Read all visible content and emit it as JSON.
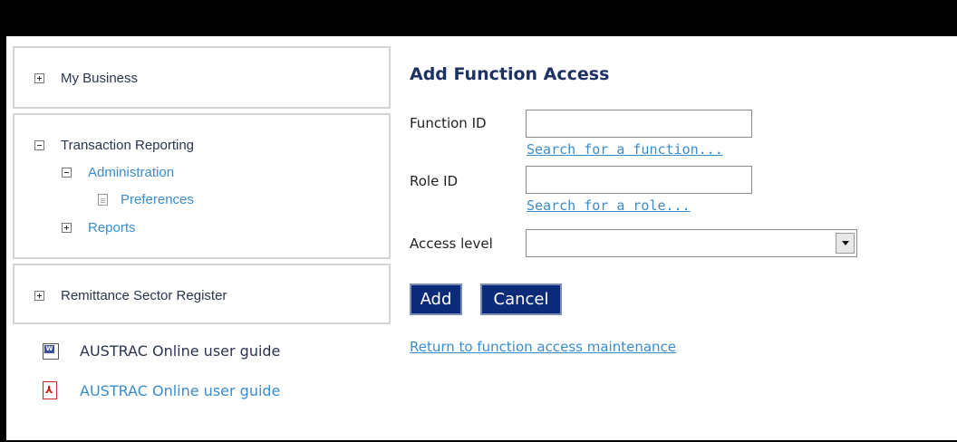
{
  "nav": {
    "my_business": "My Business",
    "transaction_reporting": "Transaction Reporting",
    "administration": "Administration",
    "preferences": "Preferences",
    "reports": "Reports",
    "remittance_sector_register": "Remittance Sector Register"
  },
  "guides": [
    {
      "label": "AUSTRAC Online user guide",
      "icon": "word-doc-icon"
    },
    {
      "label": "AUSTRAC Online user guide",
      "icon": "pdf-icon"
    }
  ],
  "form": {
    "title": "Add Function Access",
    "function_id_label": "Function ID",
    "function_id_value": "",
    "search_function_link": "Search for a function...",
    "role_id_label": "Role ID",
    "role_id_value": "",
    "search_role_link": "Search for a role...",
    "access_level_label": "Access level",
    "access_level_value": "",
    "add_button": "Add",
    "cancel_button": "Cancel",
    "return_link": "Return to function access maintenance"
  },
  "colors": {
    "title": "#1d3163",
    "link": "#3a8ccc",
    "button_bg": "#0c2a7a",
    "nav_dark": "#2a3550"
  }
}
